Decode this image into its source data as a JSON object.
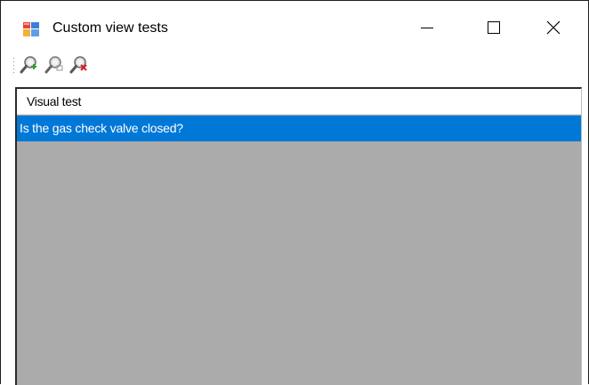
{
  "window": {
    "title": "Custom view tests"
  },
  "titlebar_buttons": {
    "minimize_icon": "minimize-icon",
    "maximize_icon": "maximize-icon",
    "close_icon": "close-icon"
  },
  "toolbar": {
    "items": [
      {
        "icon": "zoom-in-icon"
      },
      {
        "icon": "zoom-fit-icon"
      },
      {
        "icon": "zoom-remove-icon"
      }
    ]
  },
  "list": {
    "column_header": "Visual test",
    "rows": [
      {
        "text": "Is the gas check valve closed?",
        "selected": true
      }
    ]
  },
  "colors": {
    "selection": "#0078d7",
    "list_background": "#ababab"
  }
}
